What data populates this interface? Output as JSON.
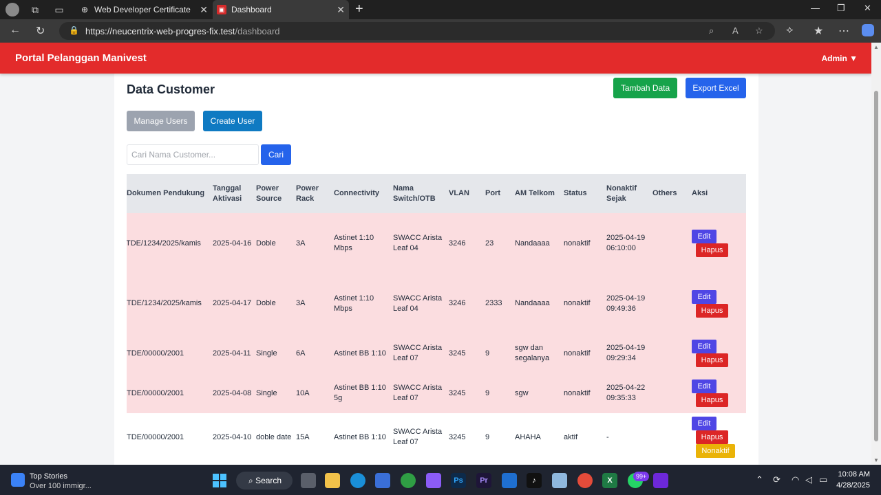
{
  "browser": {
    "tabs": [
      {
        "title": "Web Developer Certificate",
        "favicon": "globe-icon"
      },
      {
        "title": "Dashboard",
        "favicon": "app-favicon-icon"
      }
    ],
    "url_host": "https://neucentrix-web-progres-fix.test",
    "url_path": "/dashboard"
  },
  "app": {
    "brand": "Portal Pelanggan Manivest",
    "user_menu": "Admin ▼",
    "accent_color": "#e32b2b"
  },
  "page": {
    "title": "Data Customer",
    "tambah_label": "Tambah Data",
    "export_label": "Export Excel",
    "manage_label": "Manage Users",
    "create_label": "Create User",
    "search_placeholder": "Cari Nama Customer...",
    "search_button": "Cari"
  },
  "table": {
    "headers": {
      "dokumen": "Dokumen Pendukung",
      "tanggal": "Tanggal Aktivasi",
      "power_source": "Power Source",
      "power_rack": "Power Rack",
      "connectivity": "Connectivity",
      "switch": "Nama Switch/OTB",
      "vlan": "VLAN",
      "port": "Port",
      "am": "AM Telkom",
      "status": "Status",
      "nonaktif_sejak": "Nonaktif Sejak",
      "others": "Others",
      "aksi": "Aksi"
    },
    "rows": [
      {
        "dokumen": "TDE/1234/2025/kamis",
        "tanggal": "2025-04-16",
        "power_source": "Doble",
        "power_rack": "3A",
        "connectivity": "Astinet 1:10 Mbps",
        "switch": "SWACC Arista Leaf 04",
        "vlan": "3246",
        "port": "23",
        "am": "Nandaaaa",
        "status": "nonaktif",
        "nonaktif_sejak": "2025-04-19 06:10:00",
        "others": ""
      },
      {
        "dokumen": "TDE/1234/2025/kamis",
        "tanggal": "2025-04-17",
        "power_source": "Doble",
        "power_rack": "3A",
        "connectivity": "Astinet 1:10 Mbps",
        "switch": "SWACC Arista Leaf 04",
        "vlan": "3246",
        "port": "2333",
        "am": "Nandaaaa",
        "status": "nonaktif",
        "nonaktif_sejak": "2025-04-19 09:49:36",
        "others": ""
      },
      {
        "dokumen": "TDE/00000/2001",
        "tanggal": "2025-04-11",
        "power_source": "Single",
        "power_rack": "6A",
        "connectivity": "Astinet BB 1:10",
        "switch": "SWACC Arista Leaf 07",
        "vlan": "3245",
        "port": "9",
        "am": "sgw dan segalanya",
        "status": "nonaktif",
        "nonaktif_sejak": "2025-04-19 09:29:34",
        "others": ""
      },
      {
        "dokumen": "TDE/00000/2001",
        "tanggal": "2025-04-08",
        "power_source": "Single",
        "power_rack": "10A",
        "connectivity": "Astinet BB 1:10 5g",
        "switch": "SWACC Arista Leaf 07",
        "vlan": "3245",
        "port": "9",
        "am": "sgw",
        "status": "nonaktif",
        "nonaktif_sejak": "2025-04-22 09:35:33",
        "others": ""
      },
      {
        "dokumen": "TDE/00000/2001",
        "tanggal": "2025-04-10",
        "power_source": "doble date",
        "power_rack": "15A",
        "connectivity": "Astinet BB 1:10",
        "switch": "SWACC Arista Leaf 07",
        "vlan": "3245",
        "port": "9",
        "am": "AHAHA",
        "status": "aktif",
        "nonaktif_sejak": "-",
        "others": ""
      }
    ],
    "actions": {
      "edit": "Edit",
      "hapus": "Hapus",
      "nonaktif": "Nonaktif"
    }
  },
  "taskbar": {
    "news_title": "Top Stories",
    "news_sub": "Over 100 immigr...",
    "search_label": "Search",
    "badge": "99+",
    "time": "10:08 AM",
    "date": "4/28/2025"
  }
}
